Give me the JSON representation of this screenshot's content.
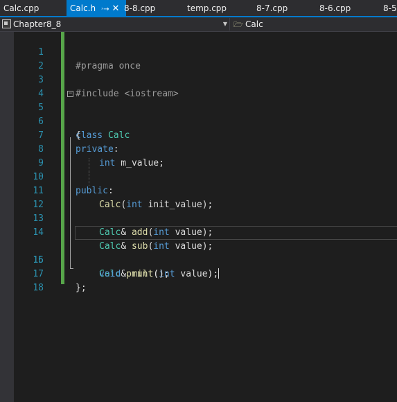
{
  "tabs": [
    {
      "label": "Calc.cpp",
      "active": false
    },
    {
      "label": "Calc.h",
      "active": true,
      "pin_icon": "pin-icon",
      "close_icon": "close-icon"
    },
    {
      "label": "8-8.cpp",
      "active": false
    },
    {
      "label": "temp.cpp",
      "active": false
    },
    {
      "label": "8-7.cpp",
      "active": false
    },
    {
      "label": "8-6.cpp",
      "active": false
    },
    {
      "label": "8-5",
      "active": false
    }
  ],
  "navbar": {
    "project": "Chapter8_8",
    "scope": "Calc",
    "project_icon": "project-icon",
    "scope_icon": "class-icon"
  },
  "editor": {
    "line_numbers": [
      "1",
      "2",
      "3",
      "4",
      "5",
      "6",
      "7",
      "8",
      "9",
      "10",
      "11",
      "12",
      "13",
      "14",
      "15",
      "16",
      "17",
      "18"
    ],
    "tokens": {
      "l1": [
        "#pragma once"
      ],
      "l3": [
        "#include <iostream>"
      ],
      "l5": [
        "class",
        " ",
        "Calc"
      ],
      "l6": [
        "{"
      ],
      "l7": [
        "private",
        ":"
      ],
      "l8": [
        "int",
        " m_value;"
      ],
      "l10": [
        "public",
        ":"
      ],
      "l11": [
        "Calc",
        "(",
        "int",
        " init_value);"
      ],
      "l13": [
        "Calc",
        "& ",
        "add",
        "(",
        "int",
        " value);"
      ],
      "l14": [
        "Calc",
        "& ",
        "sub",
        "(",
        "int",
        " value);"
      ],
      "l15": [
        "Calc",
        "& ",
        "mult",
        "(",
        "int",
        " value);"
      ],
      "l16": [
        "void",
        " ",
        "print",
        "();"
      ],
      "l17": [
        "};"
      ]
    }
  },
  "colors": {
    "accent": "#007acc",
    "keyword": "#569cd6",
    "type": "#4ec9b0",
    "function": "#dcdcaa",
    "line_number": "#2b91af",
    "change_bar": "#57a64a"
  }
}
